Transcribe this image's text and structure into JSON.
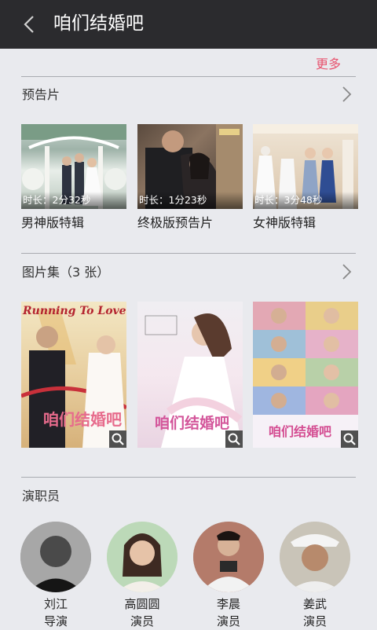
{
  "header": {
    "title": "咱们结婚吧"
  },
  "more_link": "更多",
  "trailers": {
    "title": "预告片",
    "items": [
      {
        "duration": "时长：2分32秒",
        "name": "男神版特辑"
      },
      {
        "duration": "时长：1分23秒",
        "name": "终极版预告片"
      },
      {
        "duration": "时长：3分48秒",
        "name": "女神版特辑"
      }
    ]
  },
  "gallery": {
    "title": "图片集（3 张）"
  },
  "cast": {
    "title": "演职员",
    "members": [
      {
        "name": "刘江",
        "role": "导演"
      },
      {
        "name": "高圆圆",
        "role": "演员"
      },
      {
        "name": "李晨",
        "role": "演员"
      },
      {
        "name": "姜武",
        "role": "演员"
      }
    ]
  },
  "poster_text": {
    "p1": "Running To Love",
    "p2": "咱们结婚吧",
    "p3": "咱们结婚吧"
  }
}
